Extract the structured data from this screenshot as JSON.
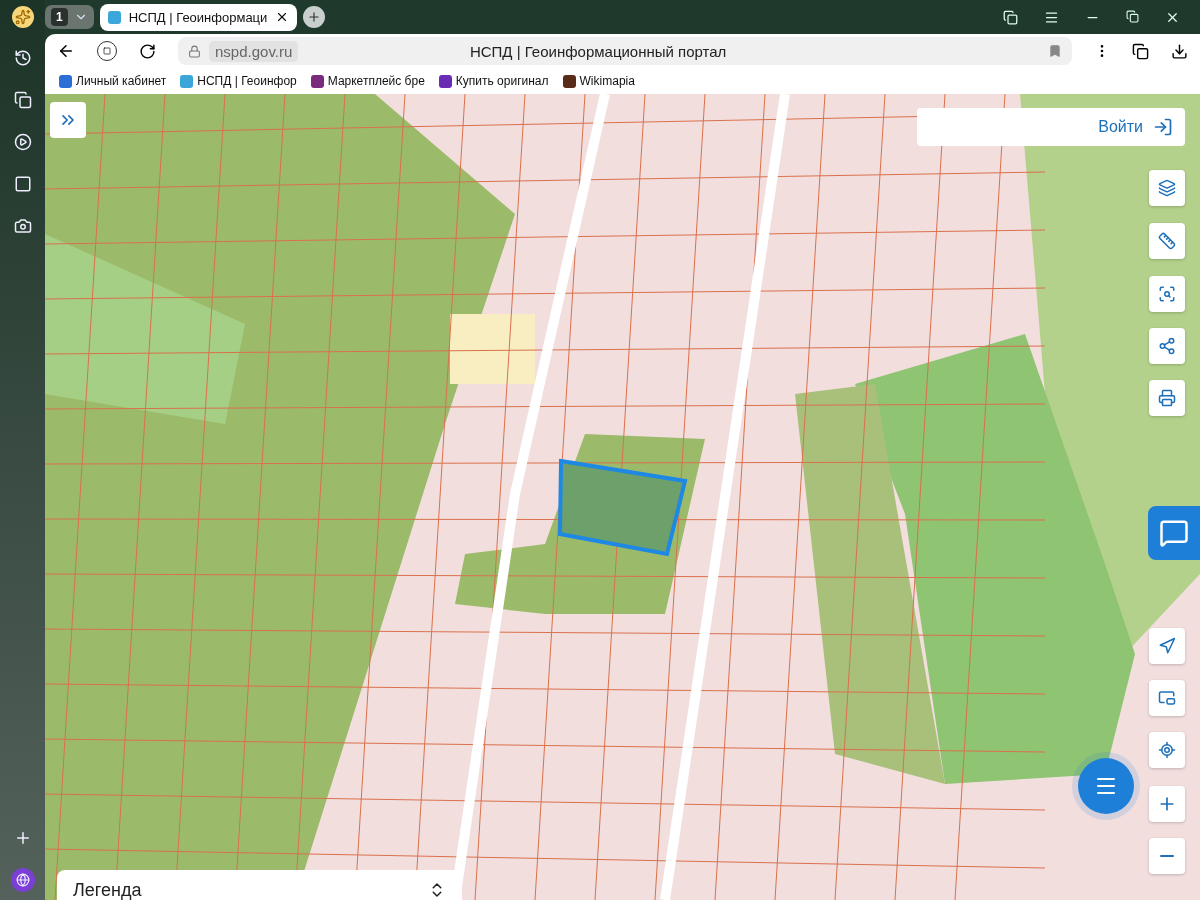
{
  "browser": {
    "tab_count": "1",
    "tabs": [
      {
        "title": "НСПД | Геоинформаци",
        "selected": true
      }
    ]
  },
  "address_bar": {
    "domain": "nspd.gov.ru",
    "page_title": "НСПД | Геоинформационный портал"
  },
  "bookmarks": [
    "Личный кабинет",
    "НСПД | Геоинфор",
    "Маркетплейс бре",
    "Купить оригинал",
    "Wikimapia"
  ],
  "map": {
    "login_button": "Войти",
    "legend": {
      "title": "Легенда",
      "expanded": false
    }
  }
}
